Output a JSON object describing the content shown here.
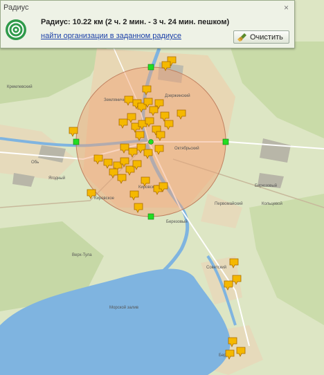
{
  "panel": {
    "title": "Радиус",
    "close_glyph": "×",
    "radius_text": "Радиус: 10.22 км (2 ч. 2 мин. - 3 ч. 24 мин. пешком)",
    "org_link": "найти организации в заданном радиусе",
    "clear_label": "Очистить",
    "icon": "radar-icon",
    "clear_icon": "broom-icon"
  },
  "map": {
    "labels": [
      "Кремлевский",
      "Земляничный",
      "Дзержинский",
      "Октябрьский",
      "Обь",
      "Ягодный",
      "Кировский",
      "Бирюзовый",
      "Кольцевой",
      "Березовый",
      "Советский",
      "Берды",
      "Морской залив",
      "Первомайский",
      "Кировское",
      "Верх-Тула"
    ],
    "colors": {
      "circle_fill": "#f2a070",
      "marker": "#f5b800",
      "handle": "#22dd22",
      "water": "#7fb4e0"
    }
  }
}
